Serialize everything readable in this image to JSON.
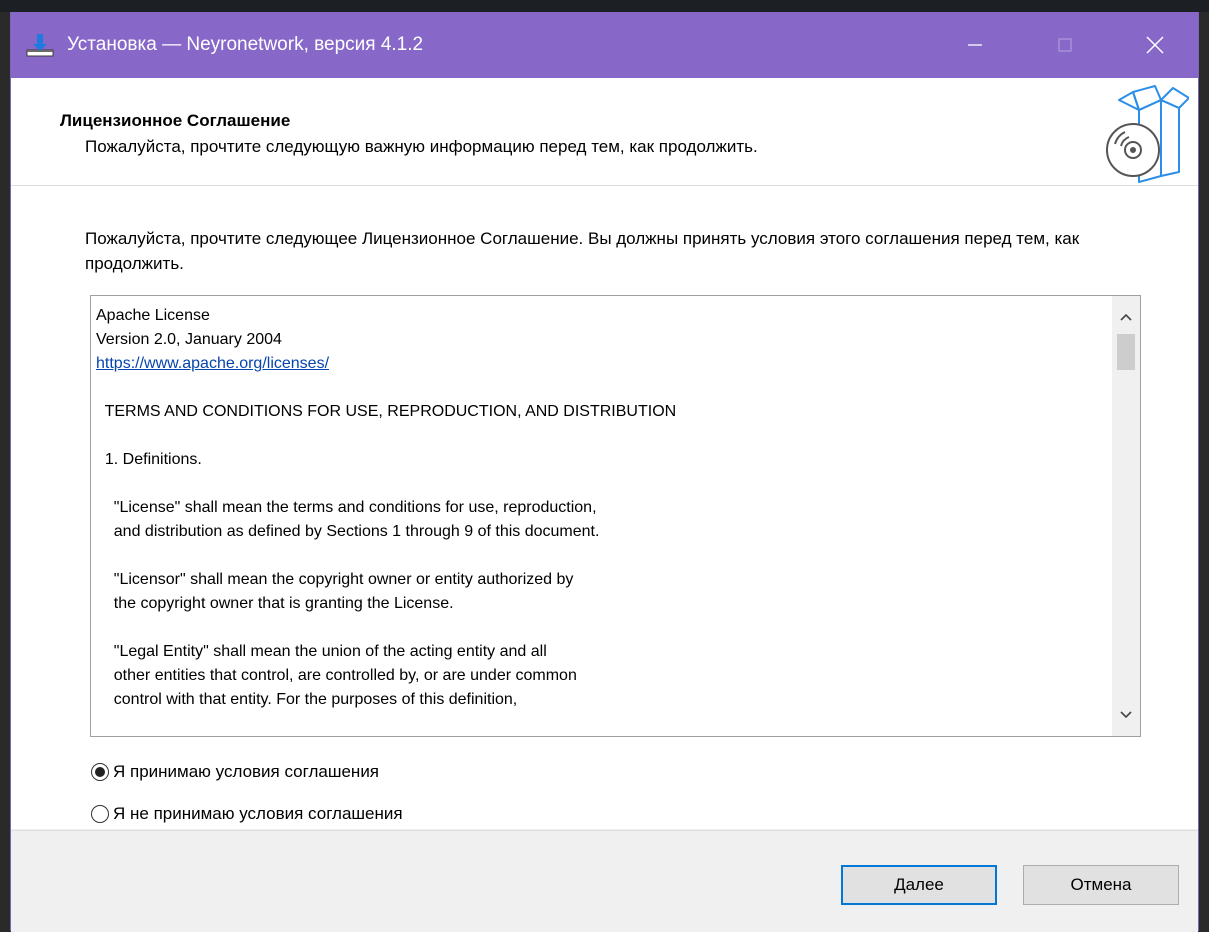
{
  "window": {
    "title": "Установка — Neyronetwork, версия 4.1.2"
  },
  "header": {
    "title": "Лицензионное Соглашение",
    "subtitle": "Пожалуйста, прочтите следующую важную информацию перед тем, как продолжить."
  },
  "body": {
    "intro": "Пожалуйста, прочтите следующее Лицензионное Соглашение. Вы должны принять условия этого соглашения перед тем, как продолжить.",
    "license": {
      "line1": "Apache License",
      "line2": "Version 2.0, January 2004",
      "link": "https://www.apache.org/licenses/",
      "line3": "  TERMS AND CONDITIONS FOR USE, REPRODUCTION, AND DISTRIBUTION",
      "line4": "  1. Definitions.",
      "line5": "    \"License\" shall mean the terms and conditions for use, reproduction,",
      "line6": "    and distribution as defined by Sections 1 through 9 of this document.",
      "line7": "    \"Licensor\" shall mean the copyright owner or entity authorized by",
      "line8": "    the copyright owner that is granting the License.",
      "line9": "    \"Legal Entity\" shall mean the union of the acting entity and all",
      "line10": "    other entities that control, are controlled by, or are under common",
      "line11": "    control with that entity. For the purposes of this definition,"
    }
  },
  "options": {
    "accept_label": "Я принимаю условия соглашения",
    "decline_label": "Я не принимаю условия соглашения",
    "selected": "accept"
  },
  "footer": {
    "next_label": "Далее",
    "cancel_label": "Отмена"
  },
  "icons": {
    "app": "installer-download-icon",
    "header": "software-box-disc-icon",
    "minimize": "minimize-icon",
    "maximize": "maximize-icon",
    "close": "close-icon"
  },
  "colors": {
    "titlebar": "#8768c8",
    "link": "#0645ad",
    "default_button_border": "#0078d7"
  }
}
